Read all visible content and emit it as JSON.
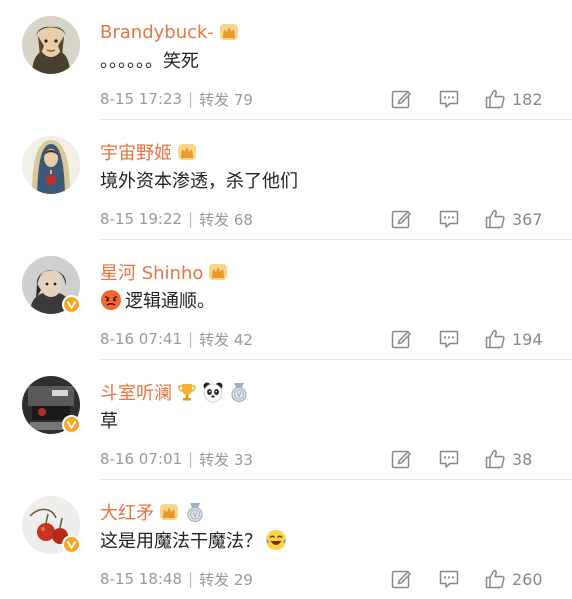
{
  "comments": [
    {
      "user": "Brandybuck-",
      "text": "。。。。。。笑死",
      "date": "8-15 17:23",
      "repost": "转发 79",
      "likes": "182"
    },
    {
      "user": "宇宙野姬",
      "text": "境外资本渗透，杀了他们",
      "date": "8-15 19:22",
      "repost": "转发 68",
      "likes": "367"
    },
    {
      "user": "星河 Shinho",
      "text": "逻辑通顺。",
      "date": "8-16 07:41",
      "repost": "转发 42",
      "likes": "194"
    },
    {
      "user": "斗室听澜",
      "text": "草",
      "date": "8-16 07:01",
      "repost": "转发 33",
      "likes": "38"
    },
    {
      "user": "大红矛",
      "text": "这是用魔法干魔法？",
      "date": "8-15 18:48",
      "repost": "转发 29",
      "likes": "260"
    }
  ],
  "icons": {
    "edit": "edit-icon",
    "comment": "comment-icon",
    "like": "thumbs-up-icon",
    "crown": "crown-badge-icon",
    "verified": "verified-v-icon"
  },
  "colors": {
    "username": "#eb7340",
    "meta": "#999999",
    "verified": "#f5a623"
  }
}
